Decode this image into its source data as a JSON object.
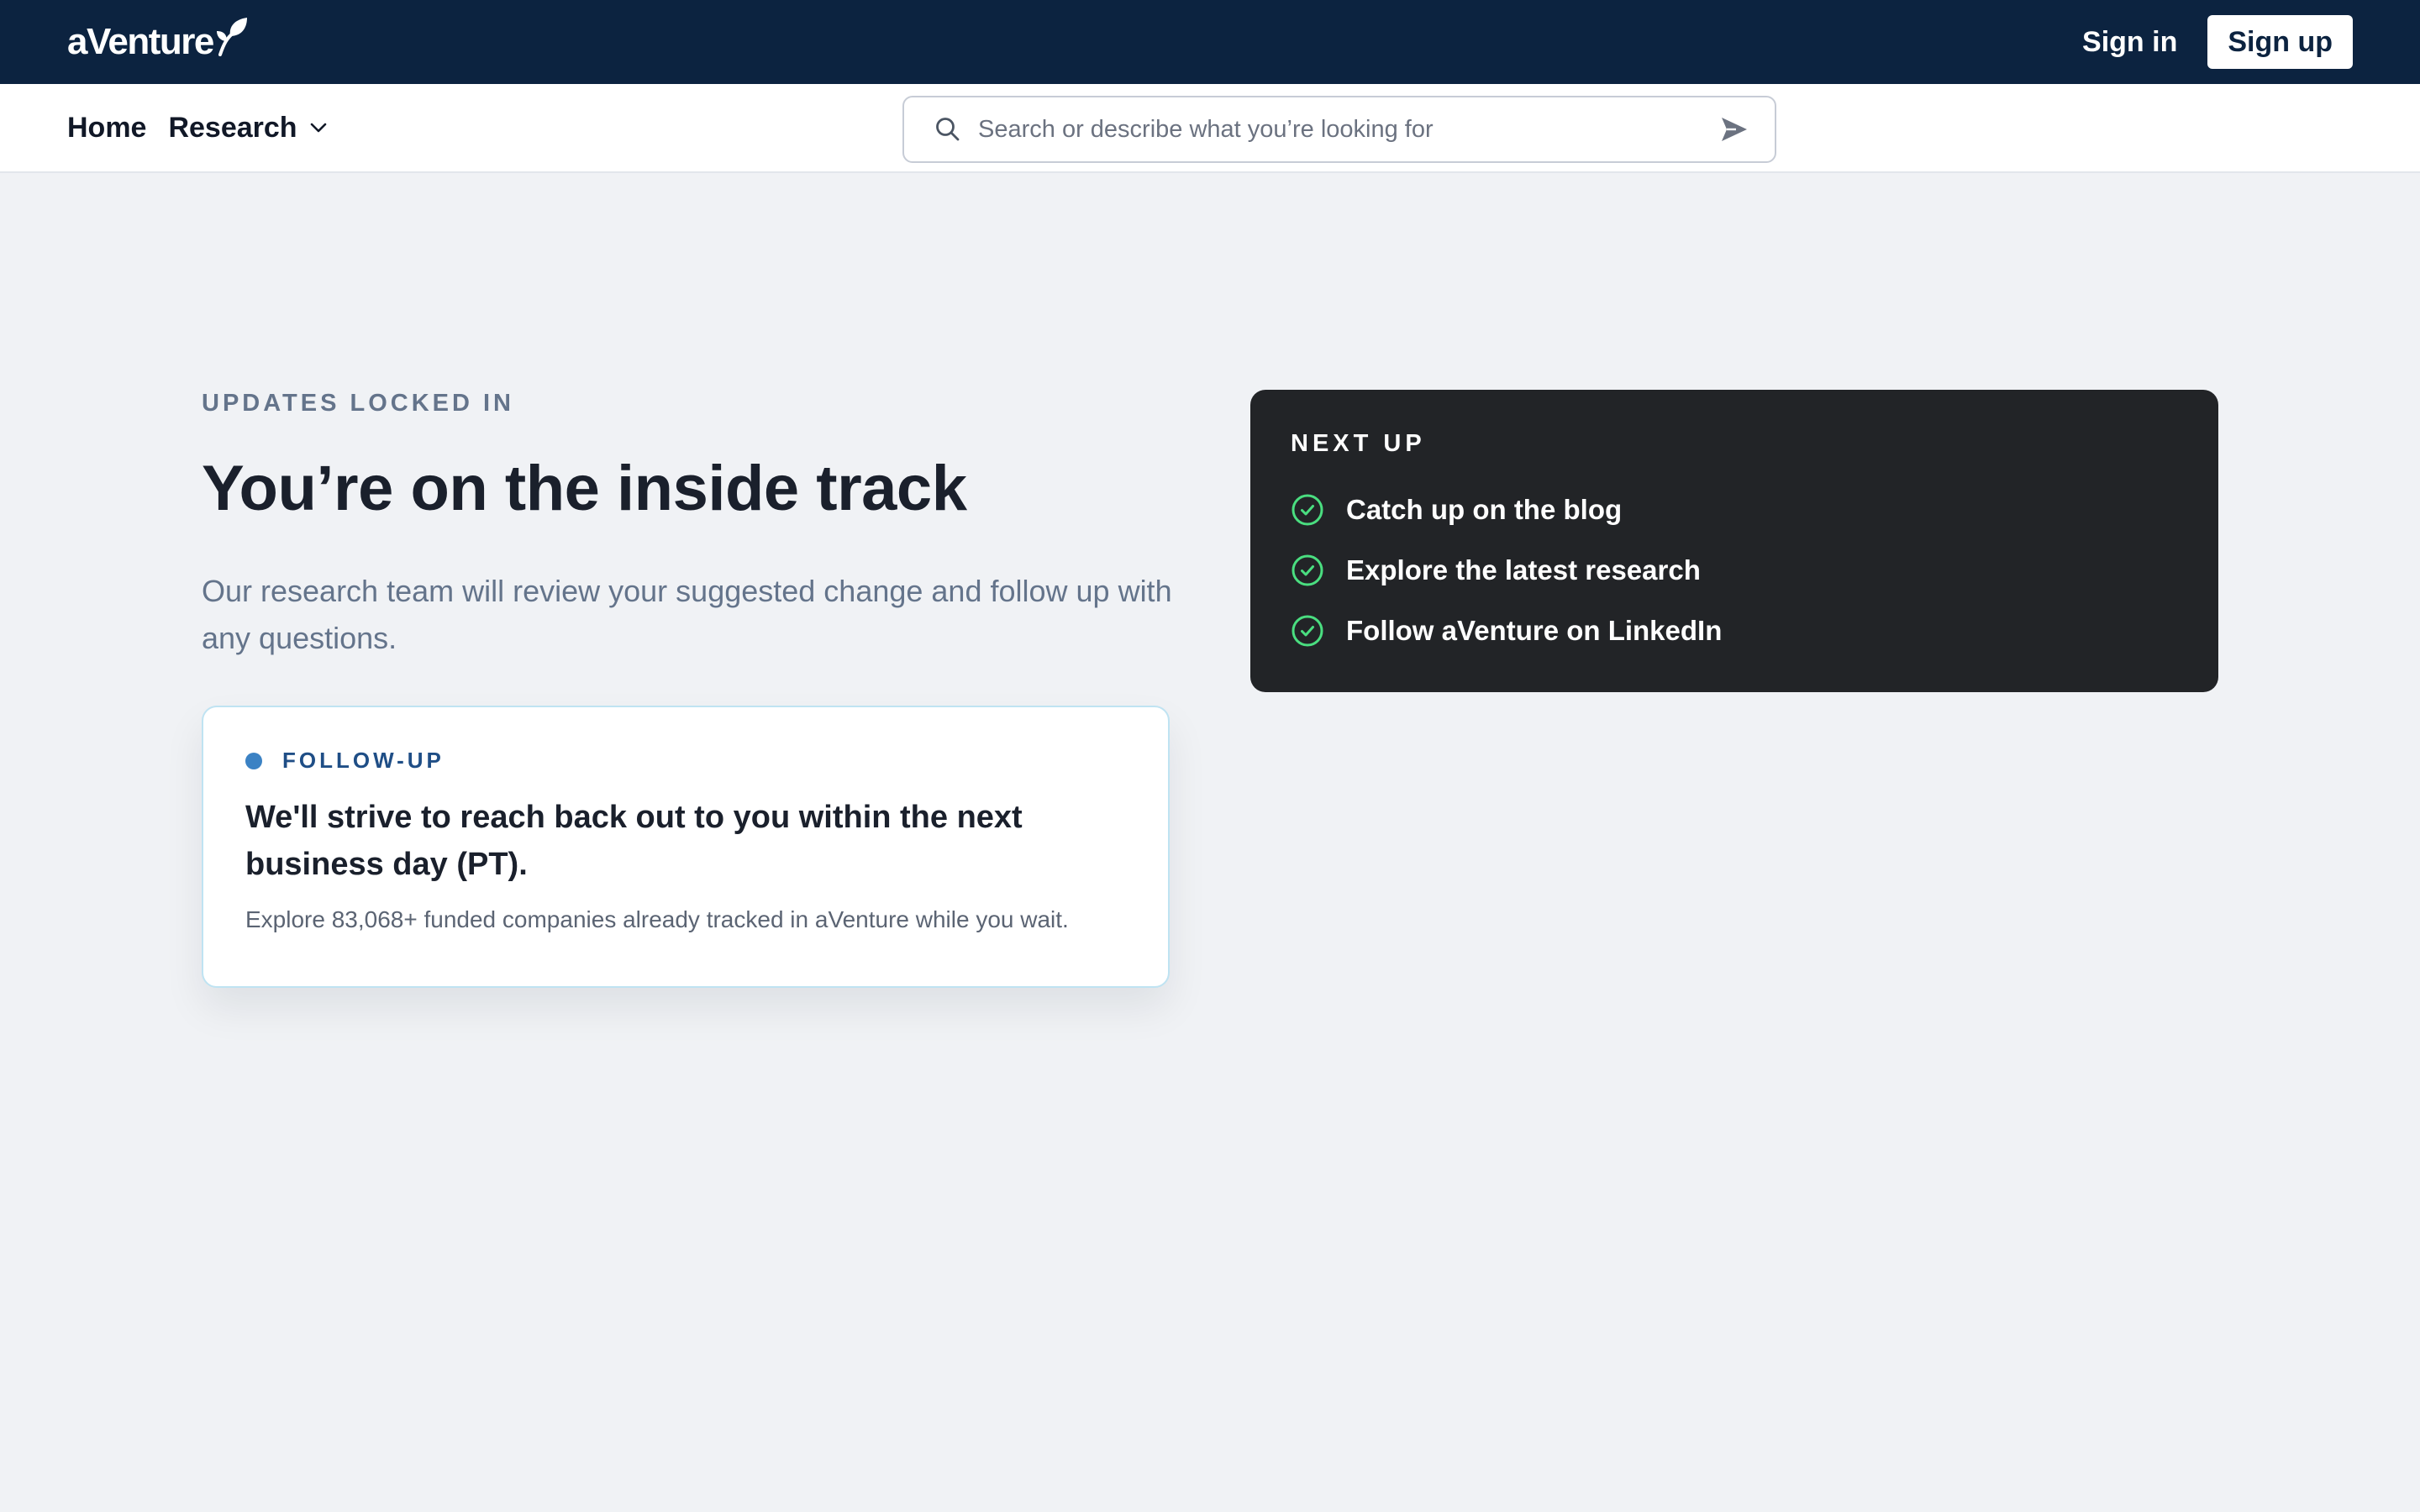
{
  "header": {
    "logo_text": "aVenture",
    "sign_in_label": "Sign in",
    "sign_up_label": "Sign up",
    "background_color": "#0c2340"
  },
  "nav": {
    "items": [
      {
        "label": "Home"
      },
      {
        "label": "Research",
        "icon": "chevron-down-icon"
      }
    ],
    "search": {
      "value": "",
      "placeholder": "Search or describe what you’re looking for",
      "leading_icon": "search-icon",
      "trailing_icon": "send-icon"
    }
  },
  "main": {
    "eyebrow": "UPDATES LOCKED IN",
    "headline": "You’re on the inside track",
    "lead": "Our research team will review your suggested change and follow up with any questions.",
    "followup": {
      "badge": "FOLLOW-UP",
      "title": "We'll strive to reach back out to you within the next business day (PT).",
      "subtitle": "Explore 83,068+ funded companies already tracked in aVenture while you wait."
    },
    "next_up": {
      "title": "NEXT UP",
      "items": [
        {
          "label": "Catch up on the blog",
          "icon": "check-circle-icon"
        },
        {
          "label": "Explore the latest research",
          "icon": "check-circle-icon"
        },
        {
          "label": "Follow aVenture on LinkedIn",
          "icon": "check-circle-icon"
        }
      ],
      "accent_color": "#4ade80"
    }
  }
}
